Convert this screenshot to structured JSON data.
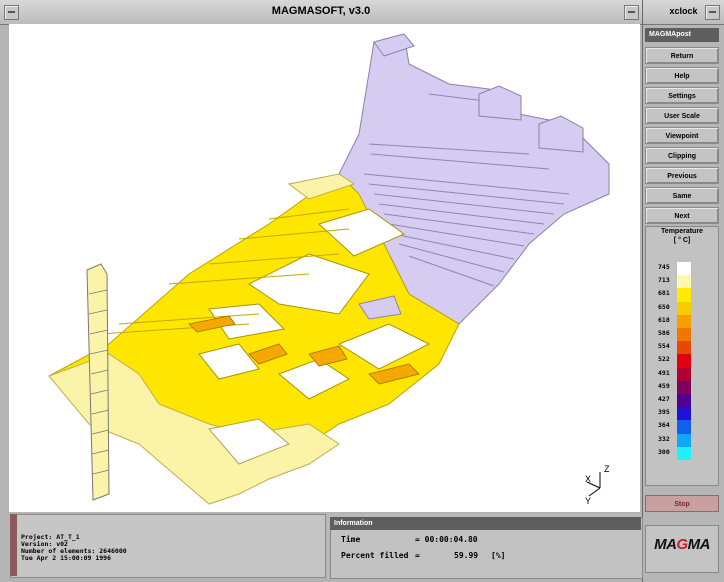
{
  "main_window": {
    "title": "MAGMASOFT, v3.0"
  },
  "side_window": {
    "title": "xclock",
    "panel_title": "MAGMApost",
    "buttons": [
      {
        "label": "Return"
      },
      {
        "label": "Help"
      },
      {
        "label": "Settings"
      },
      {
        "label": "User Scale"
      },
      {
        "label": "Viewpoint"
      },
      {
        "label": "Clipping"
      },
      {
        "label": "Previous"
      },
      {
        "label": "Same"
      },
      {
        "label": "Next"
      }
    ],
    "stop_label": "Stop",
    "logo_text_a": "MA",
    "logo_text_b": "G",
    "logo_text_c": "MA"
  },
  "legend": {
    "title": "Temperature",
    "unit": "[ ° C]",
    "entries": [
      {
        "value": "745",
        "color": "#ffffff"
      },
      {
        "value": "713",
        "color": "#fff7b0"
      },
      {
        "value": "681",
        "color": "#ffec00"
      },
      {
        "value": "650",
        "color": "#f8cc00"
      },
      {
        "value": "618",
        "color": "#f5a000"
      },
      {
        "value": "586",
        "color": "#f07800"
      },
      {
        "value": "554",
        "color": "#e84800"
      },
      {
        "value": "522",
        "color": "#e00010"
      },
      {
        "value": "491",
        "color": "#b00030"
      },
      {
        "value": "459",
        "color": "#800060"
      },
      {
        "value": "427",
        "color": "#500090"
      },
      {
        "value": "395",
        "color": "#2010d8"
      },
      {
        "value": "364",
        "color": "#1060f0"
      },
      {
        "value": "332",
        "color": "#10a8f8"
      },
      {
        "value": "300",
        "color": "#20f0f8"
      }
    ]
  },
  "project": {
    "project_line": "Project:  AT_T_1",
    "version_line": "Version:  v02",
    "elements_line": "Number of elements:  2646000",
    "date_line": "Tue Apr  2 15:00:09 1996"
  },
  "information": {
    "header": "Information",
    "time_label": "Time",
    "time_value": "= 00:00:04.80",
    "filled_label": "Percent filled",
    "filled_eq": "=",
    "filled_value": "59.99",
    "filled_unit": "[%]"
  },
  "axes": {
    "x": "X",
    "y": "Y",
    "z": "Z"
  },
  "colors": {
    "solidified": "#d6ccf2",
    "hot_yellow": "#ffe600",
    "pale_yellow": "#fbf4a8"
  }
}
